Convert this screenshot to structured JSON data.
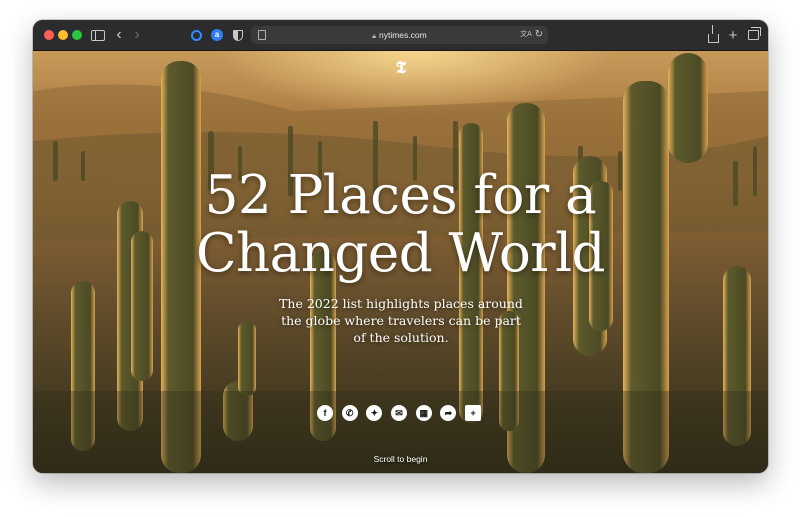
{
  "browser": {
    "url": "nytimes.com",
    "icons": {
      "sidebar": "sidebar-icon",
      "back": "chevron-left-icon",
      "forward": "chevron-right-icon",
      "extension1": "extension-circle-icon",
      "extension2": "extension-translate-icon",
      "privacy": "shield-icon",
      "page": "page-icon",
      "lock": "lock-icon",
      "translate": "translate-icon",
      "reload": "reload-icon",
      "share": "share-icon",
      "new_tab": "plus-icon",
      "tabs": "tab-overview-icon"
    },
    "colors": {
      "close": "#ff5f57",
      "minimize": "#febc2e",
      "zoom": "#28c840",
      "toolbar": "#2c2c2e"
    }
  },
  "page": {
    "logo_glyph": "𝕿",
    "headline_line1": "52 Places for a",
    "headline_line2": "Changed World",
    "subhead": "The 2022 list highlights places around the globe where travelers can be part of the solution.",
    "share_buttons": [
      {
        "icon": "facebook-icon",
        "glyph": "f"
      },
      {
        "icon": "whatsapp-icon",
        "glyph": "✆"
      },
      {
        "icon": "twitter-icon",
        "glyph": "✦"
      },
      {
        "icon": "email-icon",
        "glyph": "✉"
      },
      {
        "icon": "gift-icon",
        "glyph": "▦"
      },
      {
        "icon": "share-arrow-icon",
        "glyph": "➦"
      },
      {
        "icon": "bookmark-add-icon",
        "glyph": "+"
      }
    ],
    "scroll_label": "Scroll to begin"
  }
}
